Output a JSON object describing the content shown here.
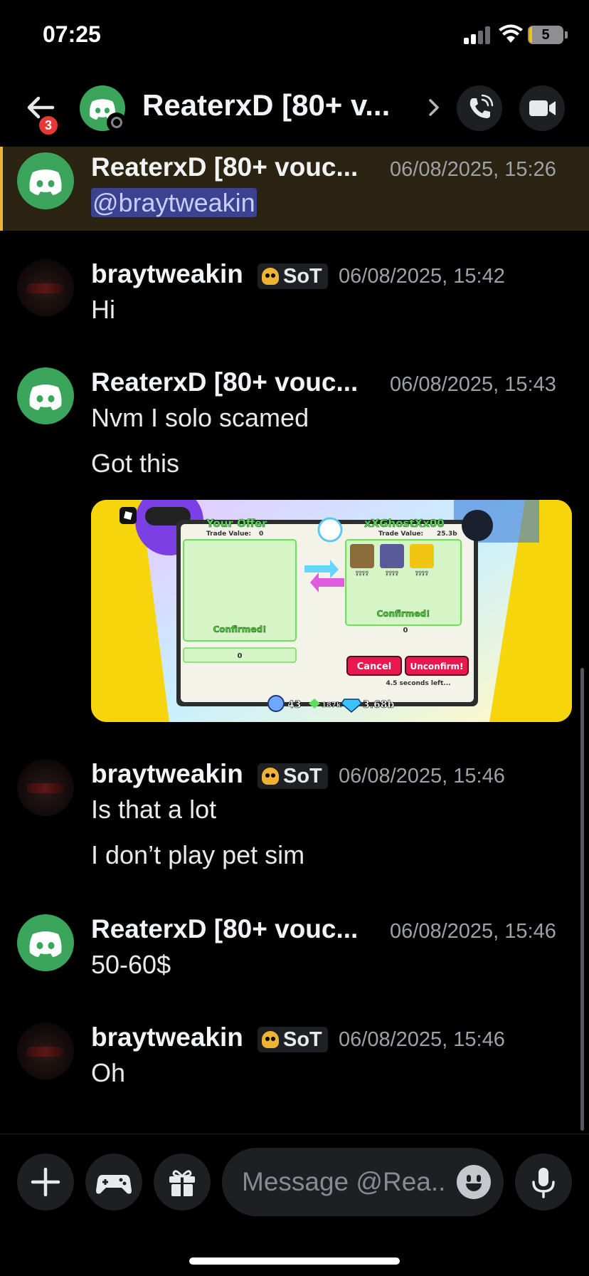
{
  "status_bar": {
    "time": "07:25",
    "battery": "5",
    "battery_fraction": 0.08,
    "signal_bars_filled": 2
  },
  "header": {
    "back_badge": "3",
    "title": "ReaterxD [80+ v...",
    "avatar_icon": "discord-logo-icon",
    "status": "offline"
  },
  "messages": [
    {
      "author": "ReaterxD [80+ vouc...",
      "timestamp": "06/08/2025, 15:26",
      "lines": [
        "@braytweakin"
      ],
      "highlighted": true,
      "avatar": "discord-logo-icon"
    },
    {
      "author": "braytweakin",
      "tag": "SoT",
      "timestamp": "06/08/2025, 15:42",
      "lines": [
        "Hi"
      ],
      "avatar": "user-photo"
    },
    {
      "author": "ReaterxD [80+ vouc...",
      "timestamp": "06/08/2025, 15:43",
      "lines": [
        "Nvm I solo scamed",
        "Got this"
      ],
      "avatar": "discord-logo-icon",
      "attachment": {
        "your_offer": "Your Offer",
        "trade_value_label": "Trade Value:",
        "your_value": "0",
        "partner_name": "xXGhostXx00",
        "partner_value": "25.3b",
        "confirmed": "Confirmed!",
        "partner_confirmed": "Confirmed!",
        "item_label": "????",
        "gems_field": "0",
        "partner_gems": "0",
        "cancel": "Cancel",
        "unconfirm": "Unconfirm!",
        "timer": "4.5 seconds left...",
        "stat1": "43",
        "stat2": "187k",
        "stat3": "3.68b"
      }
    },
    {
      "author": "braytweakin",
      "tag": "SoT",
      "timestamp": "06/08/2025, 15:46",
      "lines": [
        "Is that a lot",
        "I don’t play pet sim"
      ],
      "avatar": "user-photo"
    },
    {
      "author": "ReaterxD [80+ vouc...",
      "timestamp": "06/08/2025, 15:46",
      "lines": [
        "50-60$"
      ],
      "avatar": "discord-logo-icon"
    },
    {
      "author": "braytweakin",
      "tag": "SoT",
      "timestamp": "06/08/2025, 15:46",
      "lines": [
        "Oh"
      ],
      "avatar": "user-photo"
    }
  ],
  "composer": {
    "placeholder": "Message @Rea..",
    "buttons": [
      "plus-icon",
      "gamepad-icon",
      "gift-icon",
      "emoji-icon",
      "microphone-icon"
    ]
  },
  "colors": {
    "background": "#000000",
    "discord_green": "#3ba55c",
    "highlight_bar": "#f0b232",
    "mention_bg": "#3b4290",
    "badge_red": "#e53935"
  }
}
